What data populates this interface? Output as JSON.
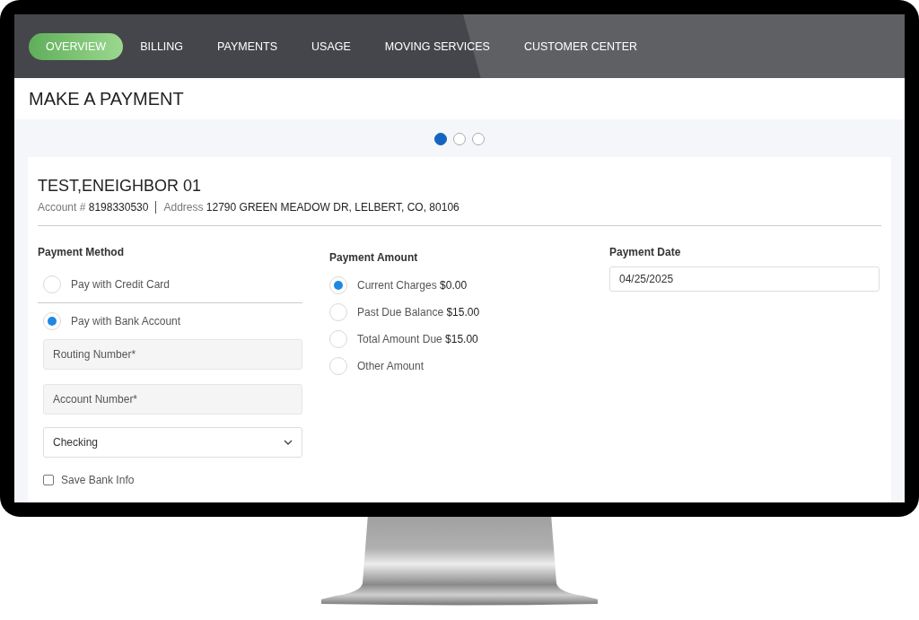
{
  "nav": [
    {
      "label": "OVERVIEW",
      "selected": true
    },
    {
      "label": "BILLING",
      "selected": false
    },
    {
      "label": "PAYMENTS",
      "selected": false
    },
    {
      "label": "USAGE",
      "selected": false
    },
    {
      "label": "MOVING SERVICES",
      "selected": false
    },
    {
      "label": "CUSTOMER CENTER",
      "selected": false
    }
  ],
  "page_title": "MAKE A PAYMENT",
  "carousel_dots": [
    {
      "selected": true
    },
    {
      "selected": false
    },
    {
      "selected": false
    }
  ],
  "customer": {
    "name": "TEST,ENEIGHBOR 01",
    "account_label": "Account #",
    "account_number": "8198330530",
    "address_label": "Address",
    "address": "12790 GREEN MEADOW DR, LELBERT, CO, 80106"
  },
  "payment_method": {
    "heading": "Payment Method",
    "options": [
      {
        "label": "Pay with Credit Card",
        "selected": false
      },
      {
        "label": "Pay with Bank Account",
        "selected": true
      }
    ],
    "routing_field": {
      "placeholder": "Routing Number*"
    },
    "account_field": {
      "placeholder": "Account Number*"
    },
    "account_type": {
      "value": "Checking"
    },
    "save_bank_info": {
      "label": "Save Bank Info",
      "checked": false
    }
  },
  "payment_amount": {
    "heading": "Payment Amount",
    "options": [
      {
        "label": "Current Charges",
        "amount": "$0.00",
        "selected": true
      },
      {
        "label": "Past Due Balance",
        "amount": "$15.00",
        "selected": false
      },
      {
        "label": "Total Amount Due",
        "amount": "$15.00",
        "selected": false
      },
      {
        "label": "Other Amount",
        "selected": false
      }
    ]
  },
  "payment_date": {
    "heading": "Payment Date",
    "value": "04/25/2025"
  }
}
